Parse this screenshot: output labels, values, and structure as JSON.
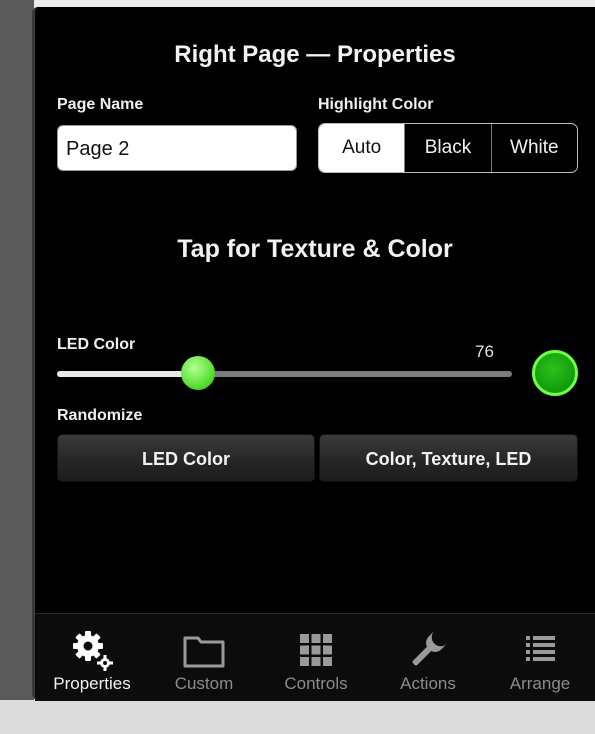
{
  "header": {
    "title": "Right Page — Properties"
  },
  "page_name": {
    "label": "Page Name",
    "value": "Page 2"
  },
  "highlight_color": {
    "label": "Highlight Color",
    "options": [
      "Auto",
      "Black",
      "White"
    ],
    "selected": "Auto"
  },
  "texture": {
    "label": "Tap for Texture & Color"
  },
  "led_slider": {
    "label": "LED Color",
    "value": "76",
    "fraction": 0.31,
    "swatch_color": "#1fb01a"
  },
  "randomize": {
    "label": "Randomize",
    "buttons": [
      "LED Color",
      "Color, Texture, LED"
    ]
  },
  "tabs": [
    {
      "label": "Properties",
      "icon": "gear-icon",
      "active": true
    },
    {
      "label": "Custom",
      "icon": "folder-icon",
      "active": false
    },
    {
      "label": "Controls",
      "icon": "grid-icon",
      "active": false
    },
    {
      "label": "Actions",
      "icon": "wrench-icon",
      "active": false
    },
    {
      "label": "Arrange",
      "icon": "list-icon",
      "active": false
    }
  ],
  "colors": {
    "accent_green": "#5ee23a",
    "panel_bg": "#000000"
  }
}
